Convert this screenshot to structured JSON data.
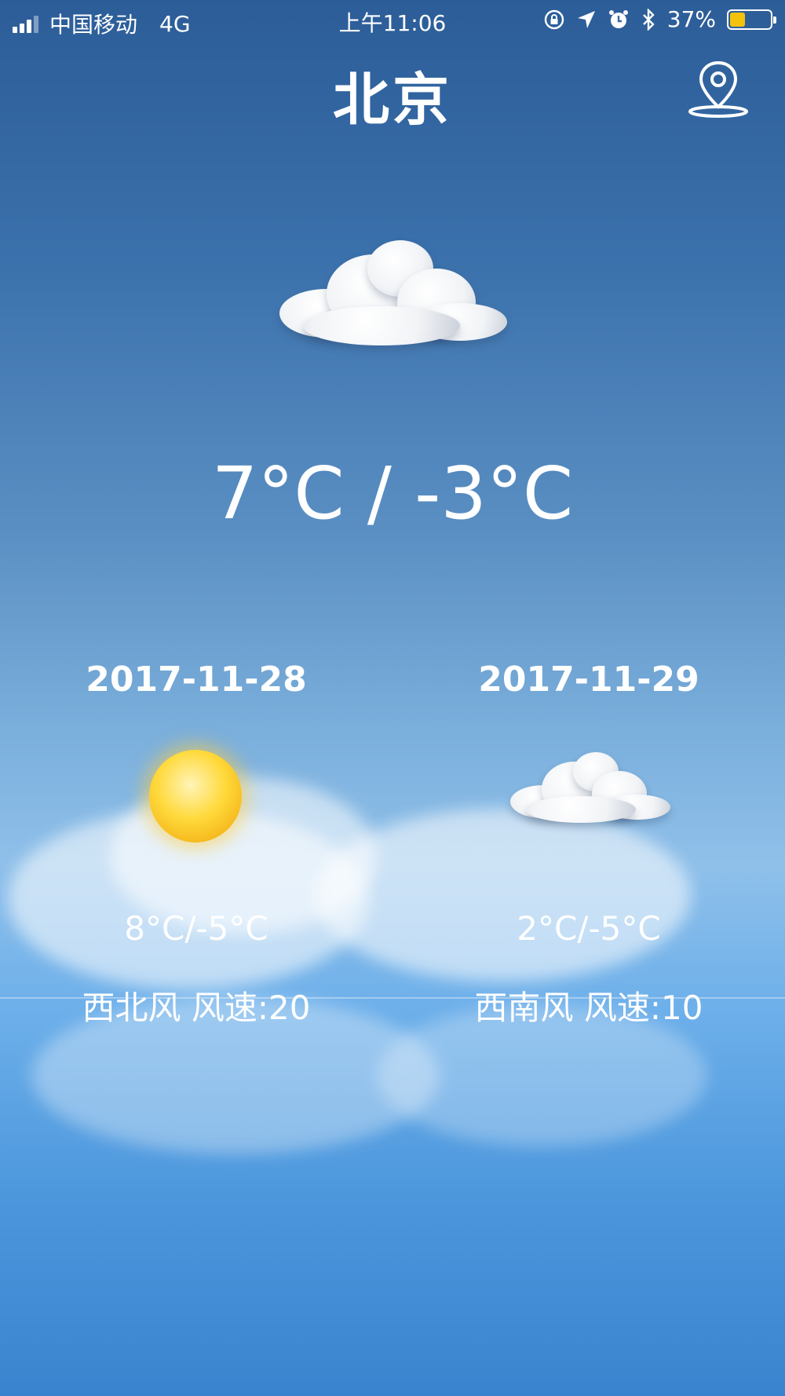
{
  "status_bar": {
    "carrier": "中国移动",
    "network": "4G",
    "time": "上午11:06",
    "battery_percent": "37%",
    "battery_level": 0.37
  },
  "header": {
    "city": "北京",
    "location_icon": "map-pin-icon"
  },
  "today": {
    "icon": "cloudy-icon",
    "temperature": "7°C / -3°C"
  },
  "forecast": [
    {
      "date": "2017-11-28",
      "icon": "sunny-icon",
      "range": "8°C/-5°C",
      "wind": "西北风 风速:20"
    },
    {
      "date": "2017-11-29",
      "icon": "cloudy-icon",
      "range": "2°C/-5°C",
      "wind": "西南风 风速:10"
    }
  ],
  "colors": {
    "sun": "#f4b51a",
    "battery_fill": "#f4c20d",
    "sky_top": "#2c5d98",
    "sky_mid": "#8fc0ea"
  }
}
